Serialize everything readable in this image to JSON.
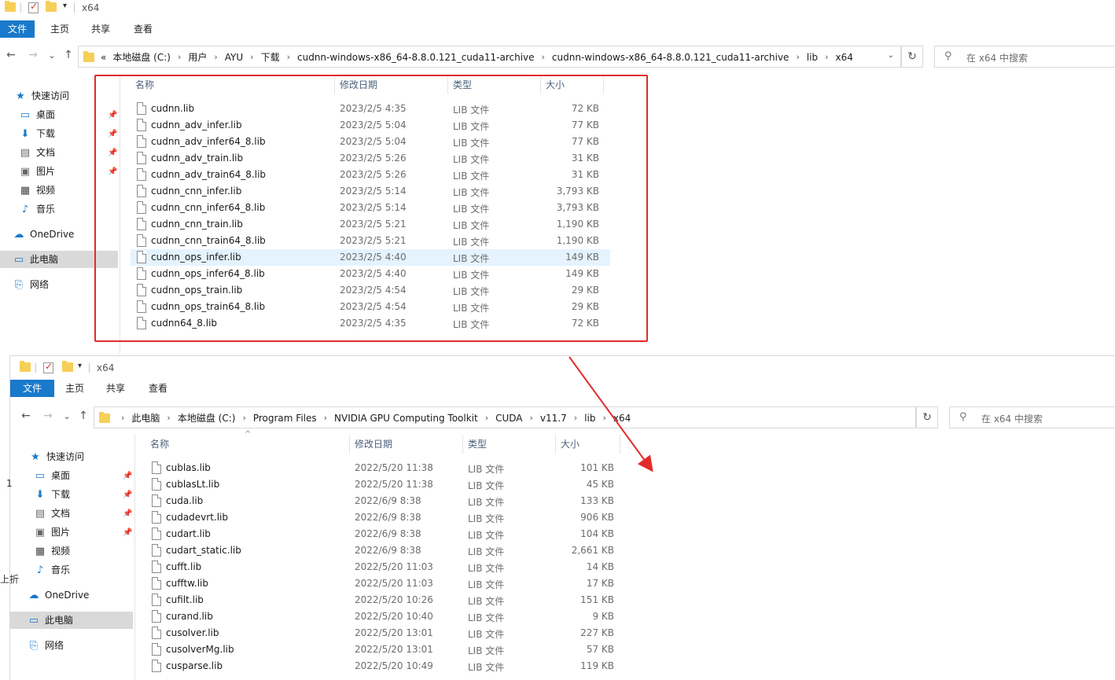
{
  "window1": {
    "title": "x64",
    "tabs": [
      "文件",
      "主页",
      "共享",
      "查看"
    ],
    "nav": {
      "back": "←",
      "forward": "→",
      "recent": "⌄",
      "up": "↑"
    },
    "breadcrumb": {
      "lead": "«",
      "items": [
        "本地磁盘 (C:)",
        "用户",
        "AYU",
        "下载",
        "cudnn-windows-x86_64-8.8.0.121_cuda11-archive",
        "cudnn-windows-x86_64-8.8.0.121_cuda11-archive",
        "lib",
        "x64"
      ]
    },
    "search_placeholder": "在 x64 中搜索",
    "sidebar": {
      "quick_access": "快速访问",
      "items": [
        {
          "label": "桌面",
          "icon": "desktop-icon"
        },
        {
          "label": "下载",
          "icon": "download-icon"
        },
        {
          "label": "文档",
          "icon": "document-icon"
        },
        {
          "label": "图片",
          "icon": "picture-icon"
        },
        {
          "label": "视频",
          "icon": "video-icon"
        },
        {
          "label": "音乐",
          "icon": "music-icon"
        }
      ],
      "onedrive": "OneDrive",
      "this_pc": "此电脑",
      "network": "网络"
    },
    "columns": {
      "name": "名称",
      "date": "修改日期",
      "type": "类型",
      "size": "大小"
    },
    "files": [
      {
        "name": "cudnn.lib",
        "date": "2023/2/5 4:35",
        "type": "LIB 文件",
        "size": "72 KB"
      },
      {
        "name": "cudnn_adv_infer.lib",
        "date": "2023/2/5 5:04",
        "type": "LIB 文件",
        "size": "77 KB"
      },
      {
        "name": "cudnn_adv_infer64_8.lib",
        "date": "2023/2/5 5:04",
        "type": "LIB 文件",
        "size": "77 KB"
      },
      {
        "name": "cudnn_adv_train.lib",
        "date": "2023/2/5 5:26",
        "type": "LIB 文件",
        "size": "31 KB"
      },
      {
        "name": "cudnn_adv_train64_8.lib",
        "date": "2023/2/5 5:26",
        "type": "LIB 文件",
        "size": "31 KB"
      },
      {
        "name": "cudnn_cnn_infer.lib",
        "date": "2023/2/5 5:14",
        "type": "LIB 文件",
        "size": "3,793 KB"
      },
      {
        "name": "cudnn_cnn_infer64_8.lib",
        "date": "2023/2/5 5:14",
        "type": "LIB 文件",
        "size": "3,793 KB"
      },
      {
        "name": "cudnn_cnn_train.lib",
        "date": "2023/2/5 5:21",
        "type": "LIB 文件",
        "size": "1,190 KB"
      },
      {
        "name": "cudnn_cnn_train64_8.lib",
        "date": "2023/2/5 5:21",
        "type": "LIB 文件",
        "size": "1,190 KB"
      },
      {
        "name": "cudnn_ops_infer.lib",
        "date": "2023/2/5 4:40",
        "type": "LIB 文件",
        "size": "149 KB"
      },
      {
        "name": "cudnn_ops_infer64_8.lib",
        "date": "2023/2/5 4:40",
        "type": "LIB 文件",
        "size": "149 KB"
      },
      {
        "name": "cudnn_ops_train.lib",
        "date": "2023/2/5 4:54",
        "type": "LIB 文件",
        "size": "29 KB"
      },
      {
        "name": "cudnn_ops_train64_8.lib",
        "date": "2023/2/5 4:54",
        "type": "LIB 文件",
        "size": "29 KB"
      },
      {
        "name": "cudnn64_8.lib",
        "date": "2023/2/5 4:35",
        "type": "LIB 文件",
        "size": "72 KB"
      }
    ],
    "highlight_color": "#e5f3ff",
    "annotation_color": "#e32b2b"
  },
  "window2": {
    "title": "x64",
    "tabs": [
      "文件",
      "主页",
      "共享",
      "查看"
    ],
    "breadcrumb": {
      "items": [
        "此电脑",
        "本地磁盘 (C:)",
        "Program Files",
        "NVIDIA GPU Computing Toolkit",
        "CUDA",
        "v11.7",
        "lib",
        "x64"
      ]
    },
    "search_placeholder": "在 x64 中搜索",
    "sidebar": {
      "quick_access": "快速访问",
      "items": [
        {
          "label": "桌面",
          "icon": "desktop-icon"
        },
        {
          "label": "下载",
          "icon": "download-icon"
        },
        {
          "label": "文档",
          "icon": "document-icon"
        },
        {
          "label": "图片",
          "icon": "picture-icon"
        },
        {
          "label": "视频",
          "icon": "video-icon"
        },
        {
          "label": "音乐",
          "icon": "music-icon"
        }
      ],
      "onedrive": "OneDrive",
      "this_pc": "此电脑",
      "network": "网络"
    },
    "columns": {
      "name": "名称",
      "date": "修改日期",
      "type": "类型",
      "size": "大小"
    },
    "files": [
      {
        "name": "cublas.lib",
        "date": "2022/5/20 11:38",
        "type": "LIB 文件",
        "size": "101 KB"
      },
      {
        "name": "cublasLt.lib",
        "date": "2022/5/20 11:38",
        "type": "LIB 文件",
        "size": "45 KB"
      },
      {
        "name": "cuda.lib",
        "date": "2022/6/9 8:38",
        "type": "LIB 文件",
        "size": "133 KB"
      },
      {
        "name": "cudadevrt.lib",
        "date": "2022/6/9 8:38",
        "type": "LIB 文件",
        "size": "906 KB"
      },
      {
        "name": "cudart.lib",
        "date": "2022/6/9 8:38",
        "type": "LIB 文件",
        "size": "104 KB"
      },
      {
        "name": "cudart_static.lib",
        "date": "2022/6/9 8:38",
        "type": "LIB 文件",
        "size": "2,661 KB"
      },
      {
        "name": "cufft.lib",
        "date": "2022/5/20 11:03",
        "type": "LIB 文件",
        "size": "14 KB"
      },
      {
        "name": "cufftw.lib",
        "date": "2022/5/20 11:03",
        "type": "LIB 文件",
        "size": "17 KB"
      },
      {
        "name": "cufilt.lib",
        "date": "2022/5/20 10:26",
        "type": "LIB 文件",
        "size": "151 KB"
      },
      {
        "name": "curand.lib",
        "date": "2022/5/20 10:40",
        "type": "LIB 文件",
        "size": "9 KB"
      },
      {
        "name": "cusolver.lib",
        "date": "2022/5/20 13:01",
        "type": "LIB 文件",
        "size": "227 KB"
      },
      {
        "name": "cusolverMg.lib",
        "date": "2022/5/20 13:01",
        "type": "LIB 文件",
        "size": "57 KB"
      },
      {
        "name": "cusparse.lib",
        "date": "2022/5/20 10:49",
        "type": "LIB 文件",
        "size": "119 KB"
      }
    ]
  },
  "stray_text": {
    "left_edge_1": "1",
    "left_edge_2": "上折"
  }
}
